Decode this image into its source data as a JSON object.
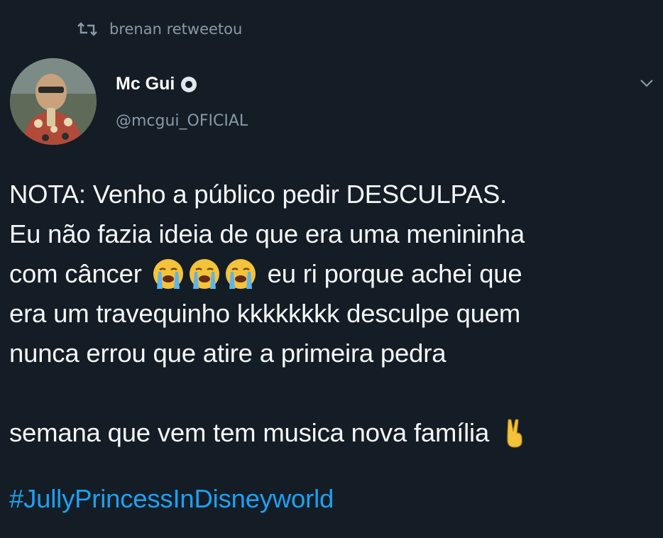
{
  "retweet": {
    "icon": "retweet-icon",
    "text": "brenan retweetou"
  },
  "author": {
    "name": "Mc Gui",
    "verified_icon": "verified-badge-icon",
    "handle": "@mcgui_OFICIAL"
  },
  "menu_icon": "chevron-down-icon",
  "tweet": {
    "line1": "NOTA: Venho a público pedir DESCULPAS.",
    "line2": "Eu não fazia ideia de que era uma menininha",
    "line3_before": "com câncer",
    "line3_emojis": [
      "loudly-crying-face-emoji",
      "loudly-crying-face-emoji",
      "loudly-crying-face-emoji"
    ],
    "line3_after": "eu ri porque achei que",
    "line4": "era um travequinho kkkkkkkk desculpe quem",
    "line5": "nunca errou que atire a primeira pedra",
    "line6": "semana que vem tem musica nova família",
    "line6_emoji": "victory-hand-emoji",
    "hashtag": "#JullyPrincessInDisneyworld"
  },
  "colors": {
    "background": "#141d26",
    "text": "#f5f8fa",
    "secondary": "#8899a6",
    "link": "#1da1f2"
  }
}
